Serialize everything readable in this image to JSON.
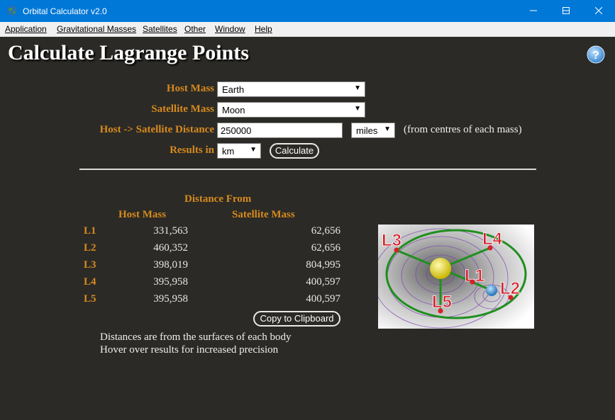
{
  "window": {
    "title": "Orbital Calculator v2.0"
  },
  "menu": [
    "Application",
    "Gravitational Masses",
    "Satellites",
    "Other",
    "Window",
    "Help"
  ],
  "page_title": "Calculate Lagrange Points",
  "form": {
    "host_mass_label": "Host Mass",
    "host_mass_value": "Earth",
    "satellite_mass_label": "Satellite Mass",
    "satellite_mass_value": "Moon",
    "distance_label": "Host -> Satellite Distance",
    "distance_value": "250000",
    "distance_unit": "miles",
    "distance_note": "(from centres of each mass)",
    "results_in_label": "Results in",
    "results_unit": "km",
    "calculate_label": "Calculate"
  },
  "results": {
    "distance_from": "Distance From",
    "col_host": "Host Mass",
    "col_satellite": "Satellite Mass",
    "rows": [
      {
        "label": "L1",
        "host": "331,563",
        "satellite": "62,656"
      },
      {
        "label": "L2",
        "host": "460,352",
        "satellite": "62,656"
      },
      {
        "label": "L3",
        "host": "398,019",
        "satellite": "804,995"
      },
      {
        "label": "L4",
        "host": "395,958",
        "satellite": "400,597"
      },
      {
        "label": "L5",
        "host": "395,958",
        "satellite": "400,597"
      }
    ],
    "copy_label": "Copy to Clipboard"
  },
  "notes": [
    "Distances are from the surfaces of each body",
    "Hover over results for increased precision"
  ],
  "diagram_labels": [
    "L3",
    "L4",
    "L1",
    "L2",
    "L5"
  ],
  "colors": {
    "accent": "#d78a1e",
    "titlebar": "#0078d7",
    "background": "#2b2a26"
  }
}
